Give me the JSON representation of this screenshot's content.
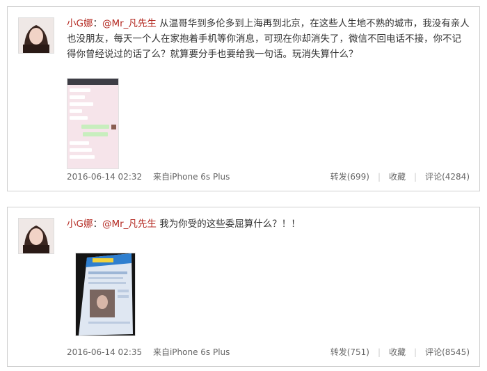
{
  "posts": [
    {
      "username": "小G娜",
      "colon": "：",
      "mention": "@Mr_凡先生",
      "text": " 从温哥华到多伦多到上海再到北京，在这些人生地不熟的城市，我没有亲人也没朋友，每天一个人在家抱着手机等你消息，可现在你却消失了，微信不回电话不接，你不记得你曾经说过的话了么？就算要分手也要给我一句话。玩消失算什么？",
      "time": "2016-06-14 02:32",
      "source": "来自iPhone 6s Plus",
      "actions": {
        "repost": "转发(699)",
        "favorite": "收藏",
        "comment": "评论(4284)"
      }
    },
    {
      "username": "小G娜",
      "colon": "：",
      "mention": "@Mr_凡先生",
      "text": " 我为你受的这些委屈算什么？！！",
      "time": "2016-06-14 02:35",
      "source": "来自iPhone 6s Plus",
      "actions": {
        "repost": "转发(751)",
        "favorite": "收藏",
        "comment": "评论(8545)"
      }
    }
  ],
  "colors": {
    "username": "#b42a22",
    "meta": "#666666",
    "border": "#cfcfcf"
  }
}
